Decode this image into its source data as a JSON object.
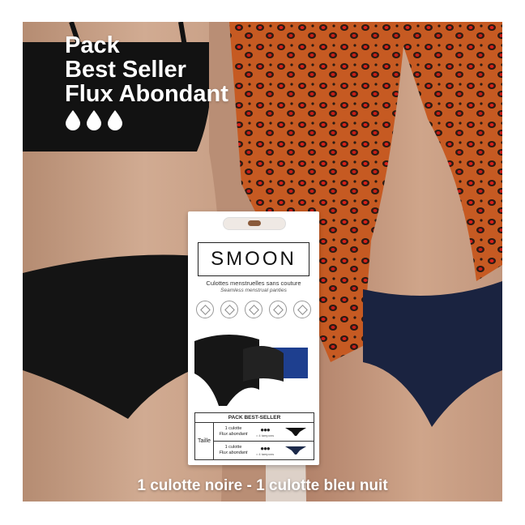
{
  "headline": {
    "line1": "Pack",
    "line2": "Best Seller",
    "line3": "Flux Abondant"
  },
  "drop_icons": [
    "drop-icon",
    "drop-icon",
    "drop-icon"
  ],
  "caption": "1 culotte noire - 1 culotte bleu nuit",
  "product": {
    "brand": "SMOON",
    "subtitle": "Culottes menstruelles sans couture",
    "subtitle_en": "Seamless menstrual panties",
    "pack_title": "PACK BEST-SELLER",
    "size_label": "Taille",
    "rows": [
      {
        "line1": "1 culotte",
        "line2": "Flux abondant",
        "tampons": "= 4 tampons",
        "color": "#111111"
      },
      {
        "line1": "1 culotte",
        "line2": "Flux abondant",
        "tampons": "= 4 tampons",
        "color": "#1c2a4a"
      }
    ]
  },
  "colors": {
    "black_panty": "#141414",
    "navy_panty": "#1a2340",
    "box_blue": "#1e3f8f",
    "shirt_orange": "#c4531c"
  }
}
